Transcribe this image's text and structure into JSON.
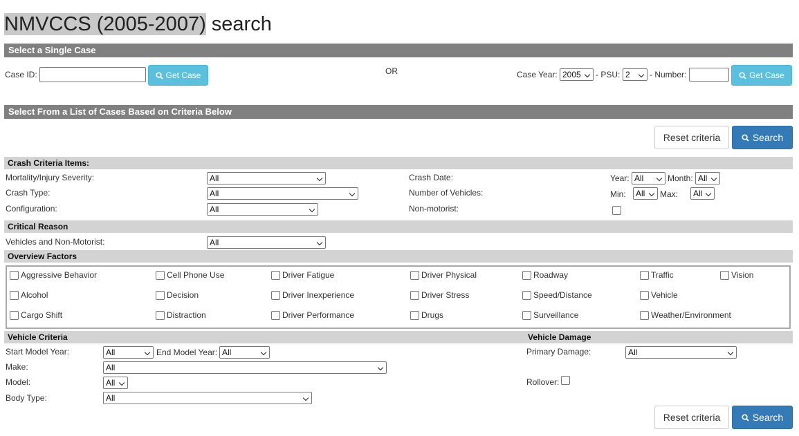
{
  "title": {
    "highlighted": "NMVCCS (2005-2007)",
    "rest": " search"
  },
  "single_case": {
    "header": "Select a Single Case",
    "case_id_label": "Case ID:",
    "case_id_value": "",
    "get_case_label": "Get Case",
    "or_label": "OR",
    "case_year_label": "Case Year:",
    "case_year_value": "2005",
    "psu_label": "- PSU:",
    "psu_value": "2",
    "number_label": "- Number:",
    "number_value": ""
  },
  "criteria": {
    "header": "Select From a List of Cases Based on Criteria Below",
    "reset_label": "Reset criteria",
    "search_label": "Search"
  },
  "crash": {
    "header": "Crash Criteria Items:",
    "mortality_label": "Mortality/Injury Severity:",
    "mortality_value": "All",
    "crash_type_label": "Crash Type:",
    "crash_type_value": "All",
    "configuration_label": "Configuration:",
    "configuration_value": "All",
    "crash_date_label": "Crash Date:",
    "year_label": "Year:",
    "year_value": "All",
    "month_label": "Month:",
    "month_value": "All",
    "num_vehicles_label": "Number of Vehicles:",
    "min_label": "Min:",
    "min_value": "All",
    "max_label": "Max:",
    "max_value": "All",
    "nonmotorist_label": "Non-motorist:"
  },
  "critical_reason": {
    "header": "Critical Reason",
    "vehicles_label": "Vehicles and Non-Motorist:",
    "vehicles_value": "All"
  },
  "overview": {
    "header": "Overview Factors",
    "items": [
      "Aggressive Behavior",
      "Cell Phone Use",
      "Driver Fatigue",
      "Driver Physical",
      "Roadway",
      "Traffic",
      "Vision",
      "Alcohol",
      "Decision",
      "Driver Inexperience",
      "Driver Stress",
      "Speed/Distance",
      "Vehicle",
      "Cargo Shift",
      "Distraction",
      "Driver Performance",
      "Drugs",
      "Surveillance",
      "Weather/Environment"
    ]
  },
  "vehicle": {
    "header": "Vehicle Criteria",
    "start_year_label": "Start Model Year:",
    "start_year_value": "All",
    "end_year_label": "End Model Year:",
    "end_year_value": "All",
    "make_label": "Make:",
    "make_value": "All",
    "model_label": "Model:",
    "model_value": "All",
    "body_label": "Body Type:",
    "body_value": "All"
  },
  "damage": {
    "header": "Vehicle Damage",
    "primary_label": "Primary Damage:",
    "primary_value": "All",
    "rollover_label": "Rollover:"
  },
  "colors": {
    "bar": "#808080",
    "subbar": "#d3d3d3",
    "info": "#5bc0de",
    "primary": "#337ab7"
  }
}
